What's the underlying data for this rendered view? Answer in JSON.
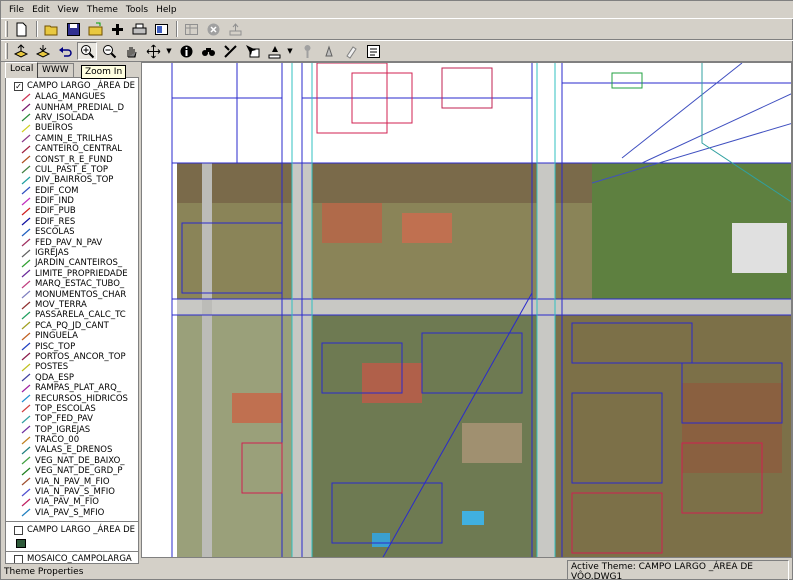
{
  "menu": [
    "File",
    "Edit",
    "View",
    "Theme",
    "Tools",
    "Help"
  ],
  "toolbar1": [
    "new-icon",
    "open-icon",
    "save-icon",
    "open-folder-icon",
    "add-theme-icon",
    "print-icon",
    "layout-icon",
    "disabled-table-icon",
    "disabled-cancel-icon",
    "disabled-export-icon"
  ],
  "toolbar2": [
    "layer-up-icon",
    "layer-down-icon",
    "undo-icon",
    "zoom-in-icon",
    "zoom-out-icon",
    "pan-hand-icon",
    "move-icon",
    "info-icon",
    "find-icon",
    "measure-icon",
    "select-icon",
    "highlight-icon",
    "disabled-pin-icon",
    "hotlink-icon",
    "eraser-icon",
    "properties-icon"
  ],
  "tooltip": "Zoom In",
  "tabs": {
    "local": "Local",
    "www": "WWW"
  },
  "theme1": {
    "title": "CAMPO LARGO _ÁREA DE",
    "checked": "✓"
  },
  "layers": [
    {
      "label": "ALAG_MANGUES",
      "color": "#cc3355"
    },
    {
      "label": "AUNHAM_PREDIAL_D",
      "color": "#7a1a6e"
    },
    {
      "label": "ARV_ISOLADA",
      "color": "#2a8a3a"
    },
    {
      "label": "BUEIROS",
      "color": "#d0d020"
    },
    {
      "label": "CAMIN_E_TRILHAS",
      "color": "#8a3a8a"
    },
    {
      "label": "CANTEIRO_CENTRAL",
      "color": "#a02040"
    },
    {
      "label": "CONST_R_E_FUND",
      "color": "#b05020"
    },
    {
      "label": "CUL_PAST_E_TOP",
      "color": "#408040"
    },
    {
      "label": "DIV_BAIRROS_TOP",
      "color": "#20a0a0"
    },
    {
      "label": "EDIF_COM",
      "color": "#3050c0"
    },
    {
      "label": "EDIF_IND",
      "color": "#c030c0"
    },
    {
      "label": "EDIF_PUB",
      "color": "#d02020"
    },
    {
      "label": "EDIF_RES",
      "color": "#1010a0"
    },
    {
      "label": "ESCOLAS",
      "color": "#2060c0"
    },
    {
      "label": "FED_PAV_N_PAV",
      "color": "#a03060"
    },
    {
      "label": "IGREJAS",
      "color": "#606060"
    },
    {
      "label": "JARDIN_CANTEIROS_",
      "color": "#30a030"
    },
    {
      "label": "LIMITE_PROPRIEDADE",
      "color": "#6a2a9a"
    },
    {
      "label": "MARQ_ESTAC_TUBO_",
      "color": "#c04080"
    },
    {
      "label": "MONUMENTOS_CHAR",
      "color": "#8080c0"
    },
    {
      "label": "MOV_TERRA",
      "color": "#903030"
    },
    {
      "label": "PASSARELA_CALC_TC",
      "color": "#20a060"
    },
    {
      "label": "PCA_PQ_JD_CANT",
      "color": "#a0a020"
    },
    {
      "label": "PINGUELA",
      "color": "#c06020"
    },
    {
      "label": "PISC_TOP",
      "color": "#2040c0"
    },
    {
      "label": "PORTOS_ANCOR_TOP",
      "color": "#8a1a4a"
    },
    {
      "label": "POSTES",
      "color": "#c0c020"
    },
    {
      "label": "QDA_ESP",
      "color": "#4040a0"
    },
    {
      "label": "RAMPAS_PLAT_ARQ_",
      "color": "#a020a0"
    },
    {
      "label": "RECURSOS_HIDRICOS",
      "color": "#2090d0"
    },
    {
      "label": "TOP_ESCOLAS",
      "color": "#d04040"
    },
    {
      "label": "TOP_FED_PAV",
      "color": "#30a0a0"
    },
    {
      "label": "TOP_IGREJAS",
      "color": "#7030a0"
    },
    {
      "label": "TRACO_00",
      "color": "#c08020"
    },
    {
      "label": "VALAS_E_DRENOS",
      "color": "#208080"
    },
    {
      "label": "VEG_NAT_DE_BAIXO_",
      "color": "#40a040"
    },
    {
      "label": "VEG_NAT_DE_GRD_P",
      "color": "#208020"
    },
    {
      "label": "VIA_N_PAV_M_FIO",
      "color": "#a05030"
    },
    {
      "label": "VIA_N_PAV_S_MFIO",
      "color": "#5050d0"
    },
    {
      "label": "VIA_PAV_M_FIO",
      "color": "#c02060"
    },
    {
      "label": "VIA_PAV_S_MFIO",
      "color": "#2080c0"
    }
  ],
  "theme2": {
    "title": "CAMPO LARGO _ÁREA DE",
    "checked": "",
    "swatch": "#2e5a3a"
  },
  "theme3": {
    "title": "MOSAICO_CAMPOLARGA"
  },
  "status": {
    "left": "Theme Properties",
    "right": "Active Theme: CAMPO LARGO _ÁREA DE VÔO.DWG1"
  }
}
